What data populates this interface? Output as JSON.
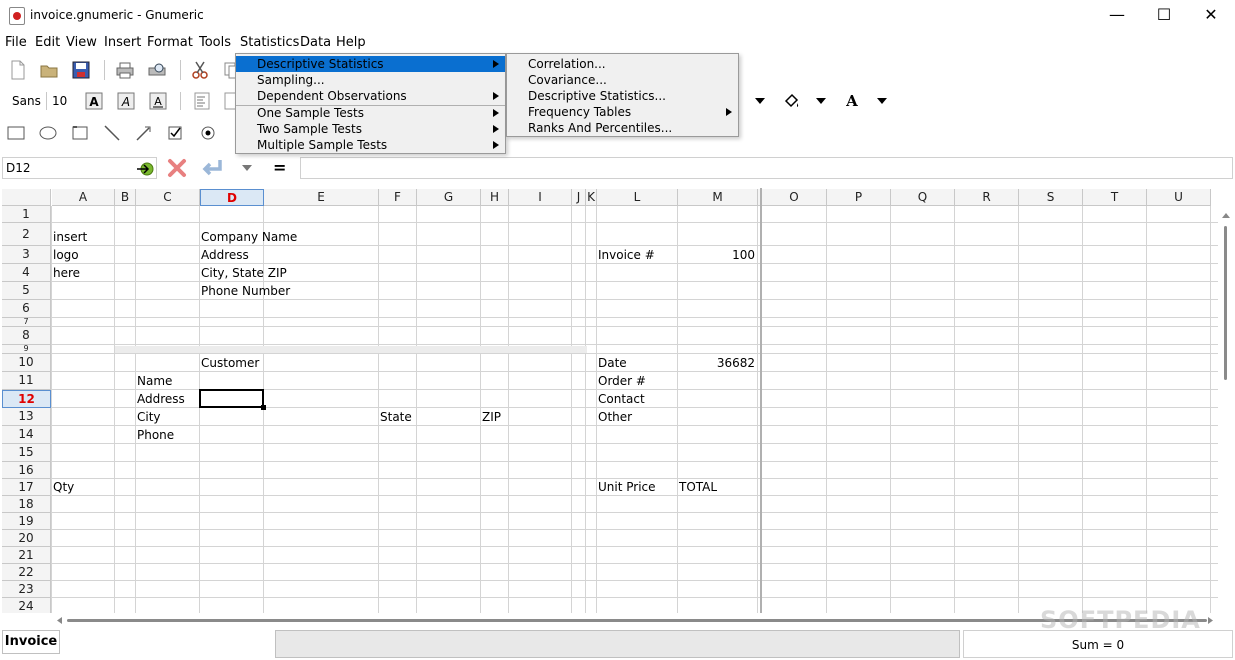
{
  "window": {
    "title": "invoice.gnumeric - Gnumeric",
    "minimize_glyph": "—",
    "maximize_glyph": "☐",
    "close_glyph": "✕"
  },
  "menubar": [
    "File",
    "Edit",
    "View",
    "Insert",
    "Format",
    "Tools",
    "Statistics",
    "Data",
    "Help"
  ],
  "format_toolbar": {
    "font_name": "Sans",
    "font_size": "10"
  },
  "formula_bar": {
    "cell_ref": "D12",
    "equals": "=",
    "value": ""
  },
  "columns": [
    "A",
    "B",
    "C",
    "D",
    "E",
    "F",
    "G",
    "H",
    "I",
    "J",
    "K",
    "L",
    "M",
    "",
    "O",
    "P",
    "Q",
    "R",
    "S",
    "T",
    "U"
  ],
  "rows": [
    "1",
    "2",
    "3",
    "4",
    "5",
    "6",
    "7",
    "8",
    "9",
    "10",
    "11",
    "12",
    "13",
    "14",
    "15",
    "16",
    "17",
    "18",
    "19",
    "20",
    "21",
    "22",
    "23",
    "24"
  ],
  "selected_cell": "D12",
  "cells": {
    "A2": "insert",
    "D2": "Company Name",
    "A3": "logo",
    "D3": "Address",
    "L3": "Invoice #",
    "M3": "100",
    "A4": "here",
    "D4": "City, State  ZIP",
    "D5": "Phone Number",
    "D10": "Customer",
    "L10": "Date",
    "M10": "36682",
    "C11": "Name",
    "L11": "Order #",
    "C12": "Address",
    "L12": "Contact",
    "C13": "City",
    "F13": "State",
    "H13": "ZIP",
    "L13": "Other",
    "C14": "Phone",
    "A17": "Qty",
    "L17": "Unit Price",
    "M17": "TOTAL"
  },
  "statistics_menu": {
    "items": [
      {
        "label": "Descriptive Statistics",
        "submenu": true,
        "highlighted": true
      },
      {
        "label": "Sampling...",
        "submenu": false
      },
      {
        "label": "Dependent Observations",
        "submenu": true
      },
      {
        "label": "One Sample Tests",
        "submenu": true
      },
      {
        "label": "Two Sample Tests",
        "submenu": true
      },
      {
        "label": "Multiple Sample Tests",
        "submenu": true
      }
    ]
  },
  "descriptive_submenu": {
    "items": [
      {
        "label": "Correlation...",
        "submenu": false
      },
      {
        "label": "Covariance...",
        "submenu": false
      },
      {
        "label": "Descriptive Statistics...",
        "submenu": false
      },
      {
        "label": "Frequency Tables",
        "submenu": true
      },
      {
        "label": "Ranks And Percentiles...",
        "submenu": false
      }
    ]
  },
  "sheet_tab": "Invoice",
  "status": {
    "sum": "Sum = 0"
  },
  "watermark": "SOFTPEDIA",
  "colors": {
    "highlight": "#0a6fd0",
    "selected_header_text": "#e00000",
    "selection_bg": "#dbe8f5"
  }
}
